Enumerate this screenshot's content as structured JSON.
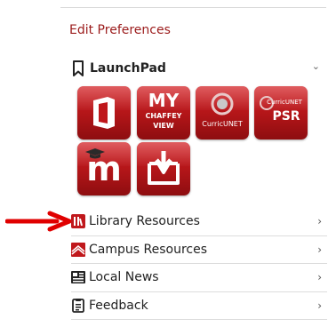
{
  "edit_link": "Edit Preferences",
  "launchpad": {
    "title": "LaunchPad",
    "tiles": [
      {
        "name": "office-tile",
        "label": ""
      },
      {
        "name": "my-chaffey-view-tile",
        "line1": "MY",
        "line2": "CHAFFEY",
        "line3": "VIEW"
      },
      {
        "name": "curricunet-tile",
        "label": "CurricUNET"
      },
      {
        "name": "curricunet-psr-tile",
        "line1": "CurricUNET",
        "line2": "PSR"
      },
      {
        "name": "moodle-tile",
        "label": "m"
      },
      {
        "name": "download-tile",
        "label": ""
      }
    ]
  },
  "menu": [
    {
      "label": "Library Resources",
      "icon": "library-icon"
    },
    {
      "label": "Campus Resources",
      "icon": "campus-icon"
    },
    {
      "label": "Local News",
      "icon": "news-icon"
    },
    {
      "label": "Feedback",
      "icon": "feedback-icon"
    }
  ],
  "colors": {
    "accent": "#9b1b1b",
    "tile_red": "#c0181c",
    "arrow": "#e00000"
  }
}
